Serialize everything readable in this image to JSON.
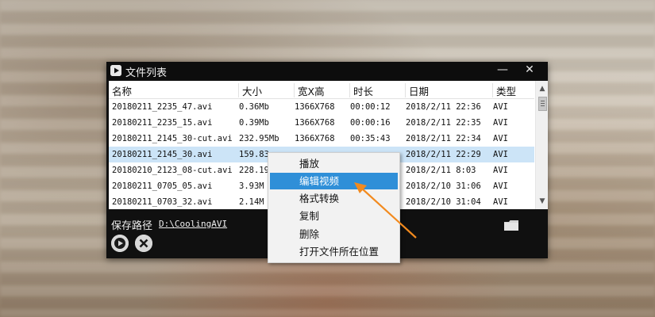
{
  "window": {
    "title": "文件列表",
    "minimize_label": "—",
    "close_label": "✕"
  },
  "table": {
    "headers": [
      "名称",
      "大小",
      "宽X高",
      "时长",
      "日期",
      "类型"
    ],
    "rows": [
      {
        "name": "20180211_2235_47.avi",
        "size": "0.36Mb",
        "res": "1366X768",
        "dur": "00:00:12",
        "date": "2018/2/11 22:36",
        "type": "AVI"
      },
      {
        "name": "20180211_2235_15.avi",
        "size": "0.39Mb",
        "res": "1366X768",
        "dur": "00:00:16",
        "date": "2018/2/11 22:35",
        "type": "AVI"
      },
      {
        "name": "20180211_2145_30-cut.avi",
        "size": "232.95Mb",
        "res": "1366X768",
        "dur": "00:35:43",
        "date": "2018/2/11 22:34",
        "type": "AVI"
      },
      {
        "name": "20180211_2145_30.avi",
        "size": "159.83",
        "res": "",
        "dur": "",
        "date": "2018/2/11 22:29",
        "type": "AVI"
      },
      {
        "name": "20180210_2123_08-cut.avi",
        "size": "228.19",
        "res": "",
        "dur": "",
        "date": "2018/2/11 8:03",
        "type": "AVI"
      },
      {
        "name": "20180211_0705_05.avi",
        "size": "3.93M",
        "res": "",
        "dur": "",
        "date": "2018/2/10 31:06",
        "type": "AVI"
      },
      {
        "name": "20180211_0703_32.avi",
        "size": "2.14M",
        "res": "",
        "dur": "",
        "date": "2018/2/10 31:04",
        "type": "AVI"
      }
    ],
    "selected_index": 3
  },
  "footer": {
    "save_label": "保存路径",
    "save_path": "D:\\CoolingAVI",
    "icons": {
      "folder": "folder-icon",
      "play": "play-icon",
      "delete": "close-circle-icon"
    }
  },
  "context_menu": {
    "items": [
      "播放",
      "编辑视频",
      "格式转换",
      "复制",
      "删除",
      "打开文件所在位置"
    ],
    "highlighted_index": 1
  },
  "colors": {
    "window_bg": "#101010",
    "selection": "#cce4f7",
    "menu_highlight": "#2f8fd8",
    "arrow": "#f28a1e"
  }
}
